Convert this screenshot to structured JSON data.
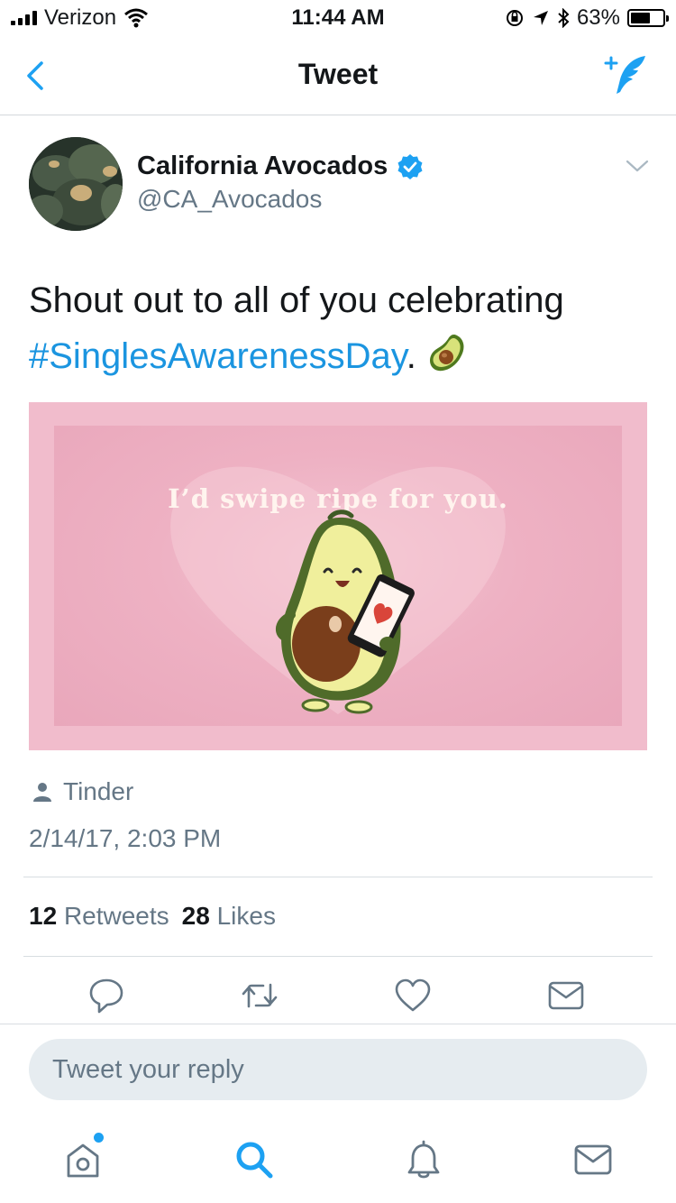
{
  "status_bar": {
    "carrier": "Verizon",
    "time": "11:44 AM",
    "battery_percent": "63%",
    "battery_level": 0.63
  },
  "nav": {
    "title": "Tweet",
    "back_icon": "chevron-left-icon",
    "compose_icon": "compose-tweet-icon"
  },
  "tweet": {
    "author_name": "California Avocados",
    "author_handle": "@CA_Avocados",
    "verified": true,
    "text_before": "Shout out to all of you celebrating ",
    "hashtag": "#SinglesAwarenessDay",
    "text_after": ". ",
    "emoji_icon": "avocado-emoji-icon",
    "media_caption": "I’d swipe ripe for you.",
    "source": "Tinder",
    "timestamp": "2/14/17, 2:03 PM",
    "retweets_count": "12",
    "retweets_label": "Retweets",
    "likes_count": "28",
    "likes_label": "Likes"
  },
  "reply": {
    "placeholder": "Tweet your reply"
  },
  "tabs": [
    "home-icon",
    "search-icon",
    "notifications-icon",
    "messages-icon"
  ],
  "colors": {
    "accent": "#1da1f2",
    "hashtag": "#1b95e0",
    "secondary_text": "#657786",
    "media_background": "#f1bccc"
  }
}
